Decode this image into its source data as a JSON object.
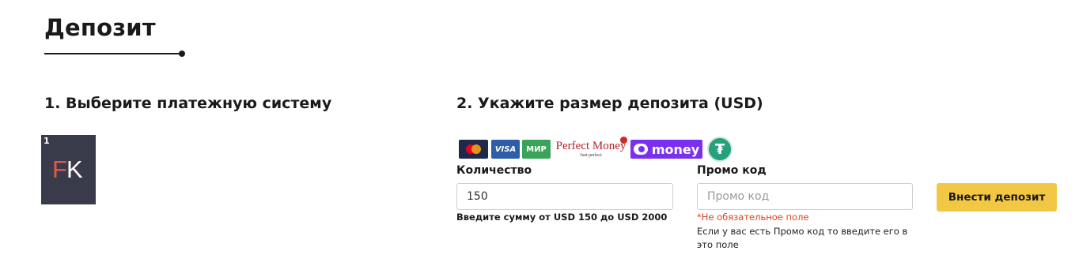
{
  "page": {
    "title": "Депозит"
  },
  "steps": {
    "step1_heading": "1. Выберите платежную систему",
    "step2_heading": "2. Укажите размер депозита (USD)"
  },
  "payment_methods": [
    {
      "index": "1",
      "logo_letters": [
        "F",
        "K"
      ],
      "selected": true
    }
  ],
  "payment_logos": {
    "mastercard": "mastercard-icon",
    "visa": "VISA",
    "mir": "МИР",
    "perfect_money": "Perfect Money",
    "perfect_money_tagline": "Just perfect",
    "yoomoney": "money",
    "tether": "₮"
  },
  "form": {
    "quantity_label": "Количество",
    "quantity_value": "150",
    "quantity_hint": "Введите сумму от USD 150 до USD 2000",
    "promo_label": "Промо код",
    "promo_placeholder": "Промо код",
    "promo_optional": "*Не обязательное поле",
    "promo_help": "Если у вас есть Промо код то введите его в это поле",
    "submit_label": "Внести депозит"
  },
  "colors": {
    "accent_button": "#f2c744",
    "tile_bg": "#3a3b4a",
    "optional_text": "#d9481c"
  }
}
